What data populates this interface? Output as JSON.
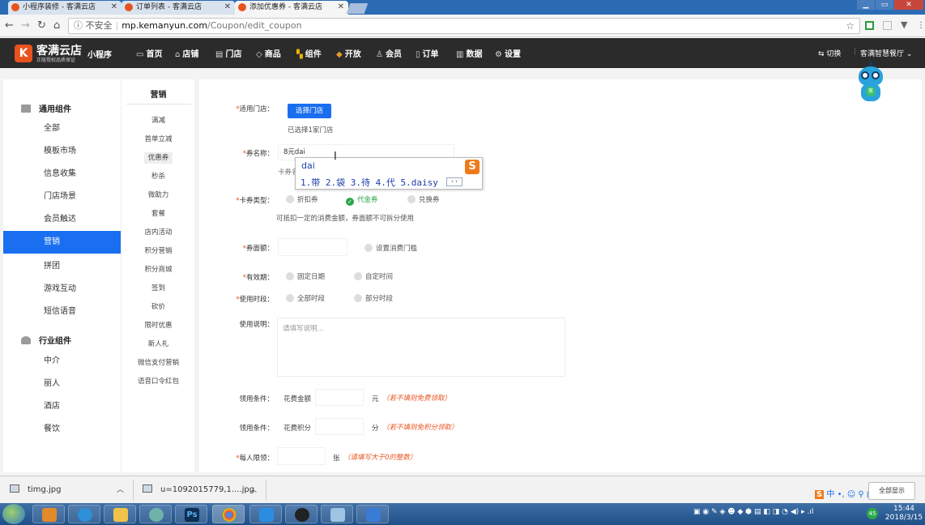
{
  "browser": {
    "tabs": [
      {
        "title": "小程序装修 - 客满云店"
      },
      {
        "title": "订单列表 - 客满云店"
      },
      {
        "title": "添加优惠券 - 客满云店"
      }
    ],
    "address": {
      "security": "不安全",
      "host": "mp.kemanyun.com",
      "path": "/Coupon/edit_coupon"
    }
  },
  "header": {
    "logo_text": "客满云店",
    "logo_sub": "正版授权品质保证",
    "product": "小程序",
    "nav": [
      {
        "label": "首页",
        "icon": "home-outline-icon"
      },
      {
        "label": "店铺",
        "icon": "house-icon"
      },
      {
        "label": "门店",
        "icon": "store-icon"
      },
      {
        "label": "商品",
        "icon": "tag-icon"
      },
      {
        "label": "组件",
        "icon": "grid-icon"
      },
      {
        "label": "开放",
        "icon": "cube-icon"
      },
      {
        "label": "会员",
        "icon": "user-icon"
      },
      {
        "label": "订单",
        "icon": "doc-icon"
      },
      {
        "label": "数据",
        "icon": "bar-chart-icon"
      },
      {
        "label": "设置",
        "icon": "gear-icon"
      }
    ],
    "switch_label": "切换",
    "account_label": "客满智慧餐厅"
  },
  "sidebar": {
    "group1": "通用组件",
    "group1_items": [
      "全部",
      "模板市场",
      "信息收集",
      "门店场景",
      "会员触达",
      "营销",
      "拼团",
      "游戏互动",
      "短信语音"
    ],
    "active_item": "营销",
    "group2": "行业组件",
    "group2_items": [
      "中介",
      "丽人",
      "酒店",
      "餐饮"
    ]
  },
  "subnav": {
    "title": "营销",
    "items": [
      "满减",
      "首单立减",
      "优惠券",
      "秒杀",
      "微助力",
      "套餐",
      "店内活动",
      "积分营销",
      "积分商城",
      "签到",
      "砍价",
      "限时优惠",
      "新人礼",
      "微信支付营销",
      "语音口令红包"
    ],
    "active_item": "优惠券"
  },
  "form": {
    "store_label": "适用门店：",
    "store_button": "选择门店",
    "store_selected": "已选择1家门店",
    "name_label": "券名称：",
    "name_value": "8元dai",
    "name_hint": "卡券名",
    "type_label": "卡券类型：",
    "type_options": [
      "折扣券",
      "代金券",
      "兑换券"
    ],
    "type_selected": "代金券",
    "type_hint": "可抵扣一定的消费金额，券面额不可拆分使用",
    "face_label": "券面额：",
    "face_option": "设置消费门槛",
    "validity_label": "有效期：",
    "validity_options": [
      "固定日期",
      "自定时间"
    ],
    "period_label": "使用时段：",
    "period_options": [
      "全部时段",
      "部分时段"
    ],
    "desc_label": "使用说明：",
    "desc_placeholder": "请填写说明...",
    "cond1_label": "领用条件：",
    "cond1_prefix": "花费金额",
    "cond1_unit": "元",
    "cond1_note": "（若不填则免费领取）",
    "cond2_label": "领用条件：",
    "cond2_prefix": "花费积分",
    "cond2_unit": "分",
    "cond2_note": "（若不填则免积分领取）",
    "limit_label": "每人限领：",
    "limit_unit": "张",
    "limit_note": "（请填写大于0的整数）"
  },
  "ime": {
    "composition": "dai",
    "candidates": "1.带  2.袋  3.待  4.代  5.daisy"
  },
  "downloads": {
    "items": [
      "timg.jpg",
      "u=1092015779,1....jpg"
    ],
    "show_all": "全部显示"
  },
  "taskbar": {
    "time": "15:44",
    "date": "2018/3/15",
    "ime_indicator": "中",
    "badge": "45"
  },
  "colors": {
    "accent_blue": "#1a6ff0",
    "brand_orange": "#e8531d",
    "success_green": "#2ba84a",
    "header_dark": "#2b2b2b"
  }
}
